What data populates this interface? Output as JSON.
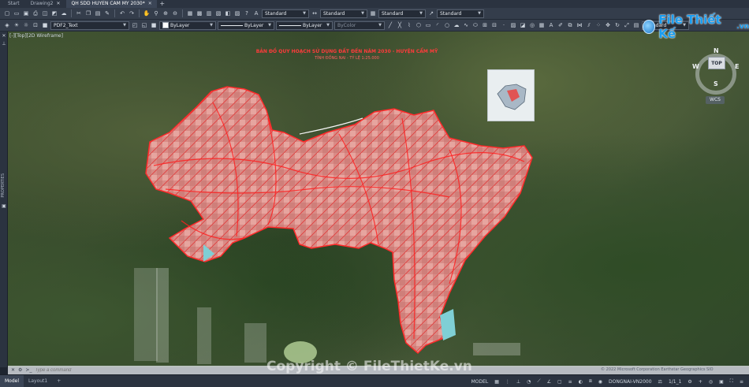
{
  "tabs": [
    {
      "label": "Start",
      "active": false
    },
    {
      "label": "Drawing2",
      "active": false,
      "closable": true
    },
    {
      "label": "QH SDD HUYEN CAM MY 2030*",
      "active": true,
      "closable": true
    }
  ],
  "toolbar": {
    "text_style": "Standard",
    "dim_style": "Standard",
    "table_style": "Standard",
    "multileader_style": "Standard",
    "layer": "PDF2_Text",
    "color": "ByLayer",
    "linetype": "ByLayer",
    "lineweight": "ByLayer",
    "plot_style": "ByColor",
    "visual_style": "Standard"
  },
  "viewport_label": "[-][Top][2D Wireframe]",
  "map": {
    "title": "BẢN ĐỒ QUY HOẠCH SỬ DỤNG ĐẤT ĐẾN NĂM 2030 - HUYỆN CẨM MỸ",
    "subtitle": "TỈNH ĐỒNG NAI - TỶ LỆ 1:25.000"
  },
  "viewcube": {
    "top": "TOP",
    "n": "N",
    "s": "S",
    "e": "E",
    "w": "W",
    "wcs": "WCS"
  },
  "left_panel": {
    "label": "PROPERTIES"
  },
  "command": {
    "placeholder": "Type a command"
  },
  "watermark": "Copyright © FileThietKe.vn",
  "attribution": "© 2022 Microsoft Corporation Earthstar Geographics SIO",
  "logo": {
    "name": "File Thiết Kế",
    "domain": ".vn"
  },
  "status": {
    "tabs": [
      {
        "label": "Model",
        "active": true
      },
      {
        "label": "Layout1",
        "active": false
      }
    ],
    "space": "MODEL",
    "coordinate_system": "DONGNAI-VN2000",
    "scale": "1/1_1"
  }
}
